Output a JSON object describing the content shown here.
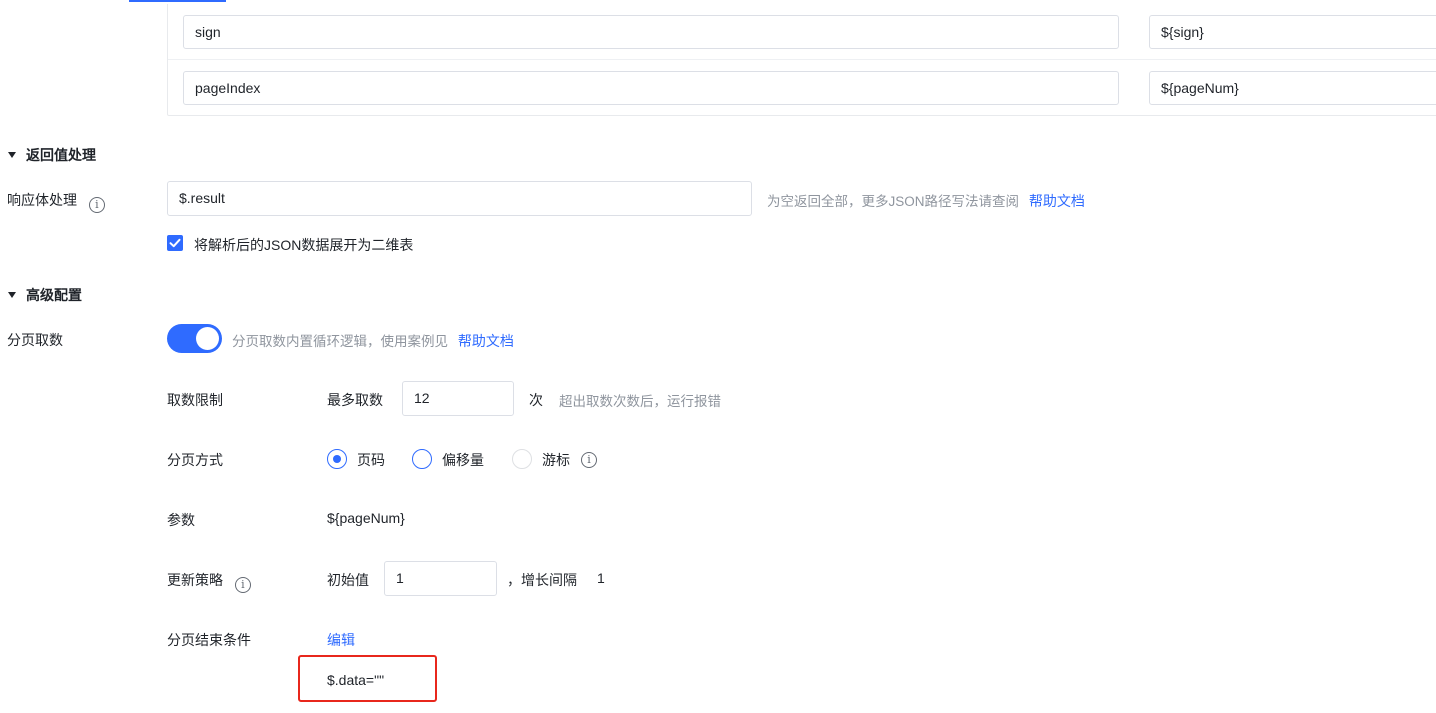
{
  "params": {
    "rows": [
      {
        "key": "sign",
        "value": "${sign}"
      },
      {
        "key": "pageIndex",
        "value": "${pageNum}"
      }
    ]
  },
  "return_section": {
    "title": "返回值处理",
    "response_label": "响应体处理",
    "response_value": "$.result",
    "response_hint": "为空返回全部，更多JSON路径写法请查阅",
    "help_link": "帮助文档",
    "flatten_label": "将解析后的JSON数据展开为二维表",
    "flatten_checked": true
  },
  "advanced_section": {
    "title": "高级配置",
    "paging_label": "分页取数",
    "paging_enabled": true,
    "paging_hint": "分页取数内置循环逻辑，使用案例见",
    "help_link": "帮助文档",
    "limit": {
      "label": "取数限制",
      "prefix": "最多取数",
      "value": "12",
      "unit": "次",
      "hint": "超出取数次数后，运行报错"
    },
    "mode": {
      "label": "分页方式",
      "options": [
        "页码",
        "偏移量",
        "游标"
      ],
      "selected": "页码"
    },
    "param": {
      "label": "参数",
      "value": "${pageNum}"
    },
    "update": {
      "label": "更新策略",
      "initial_label": "初始值",
      "initial_value": "1",
      "step_label": "，增长间隔",
      "step_value": "1"
    },
    "end_condition": {
      "label": "分页结束条件",
      "edit_link": "编辑",
      "expression": "$.data=\"\""
    }
  },
  "colors": {
    "accent": "#2f6bff",
    "highlight_border": "#e8271c",
    "hint_text": "#8f959e"
  },
  "icons": [
    "caret-down-icon",
    "info-icon",
    "checkmark-icon"
  ]
}
